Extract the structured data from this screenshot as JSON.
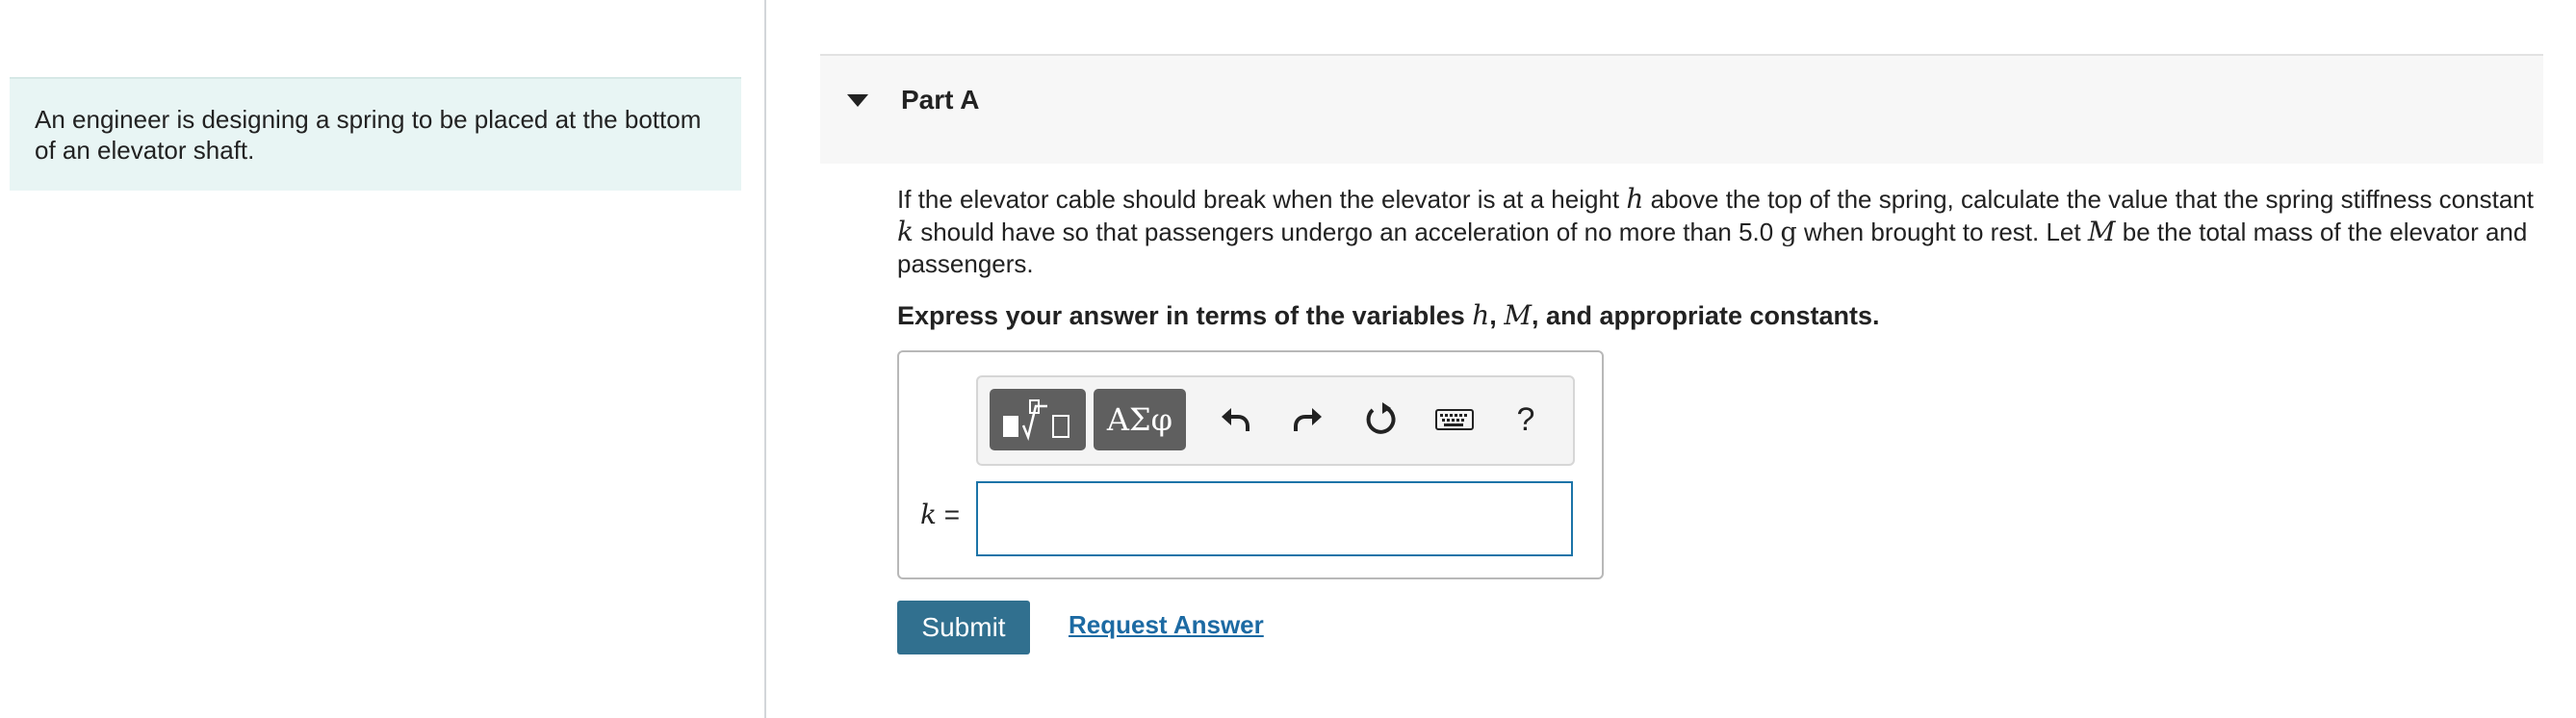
{
  "intro": {
    "text": "An engineer is designing a spring to be placed at the bottom of an elevator shaft."
  },
  "part": {
    "title": "Part A"
  },
  "question": {
    "t1": "If the elevator cable should break when the elevator is at a height ",
    "v_h": "h",
    "t2": " above the top of the spring, calculate the value that the spring stiffness constant ",
    "v_k": "k",
    "t3": " should have so that passengers undergo an acceleration of no more than 5.0 ",
    "unit_g": "g",
    "t4": " when brought to rest. Let ",
    "v_M": "M",
    "t5": " be the total mass of the elevator and passengers."
  },
  "instruction": {
    "t1": "Express your answer in terms of the variables ",
    "v_h": "h",
    "comma": ", ",
    "v_M": "M",
    "t2": ", and appropriate constants."
  },
  "toolbar": {
    "symbols_label": "ΑΣφ",
    "help_label": "?"
  },
  "answer": {
    "variable": "k",
    "equals": " =",
    "value": ""
  },
  "actions": {
    "submit_label": "Submit",
    "request_answer_label": "Request Answer"
  }
}
